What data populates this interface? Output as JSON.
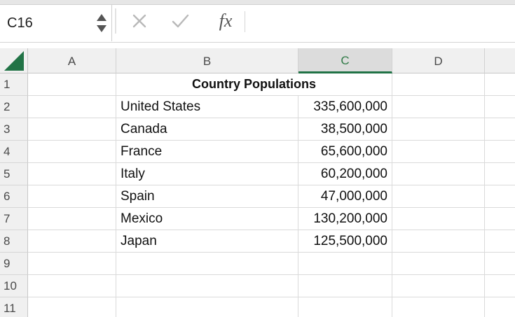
{
  "formula_bar": {
    "name_box": "C16",
    "cancel_icon": "close-icon",
    "enter_icon": "checkmark-icon",
    "fx_label": "fx",
    "formula_value": ""
  },
  "grid": {
    "columns": [
      "A",
      "B",
      "C",
      "D"
    ],
    "active_column": "C",
    "rows": [
      "1",
      "2",
      "3",
      "4",
      "5",
      "6",
      "7",
      "8",
      "9",
      "10",
      "11"
    ],
    "title": "Country Populations",
    "data": [
      {
        "country": "United States",
        "population": "335,600,000"
      },
      {
        "country": "Canada",
        "population": "38,500,000"
      },
      {
        "country": "France",
        "population": "65,600,000"
      },
      {
        "country": "Italy",
        "population": "60,200,000"
      },
      {
        "country": "Spain",
        "population": "47,000,000"
      },
      {
        "country": "Mexico",
        "population": "130,200,000"
      },
      {
        "country": "Japan",
        "population": "125,500,000"
      }
    ]
  },
  "colors": {
    "accent": "#217346",
    "header_bg": "#f0f0f0",
    "gridline": "#dadada"
  }
}
